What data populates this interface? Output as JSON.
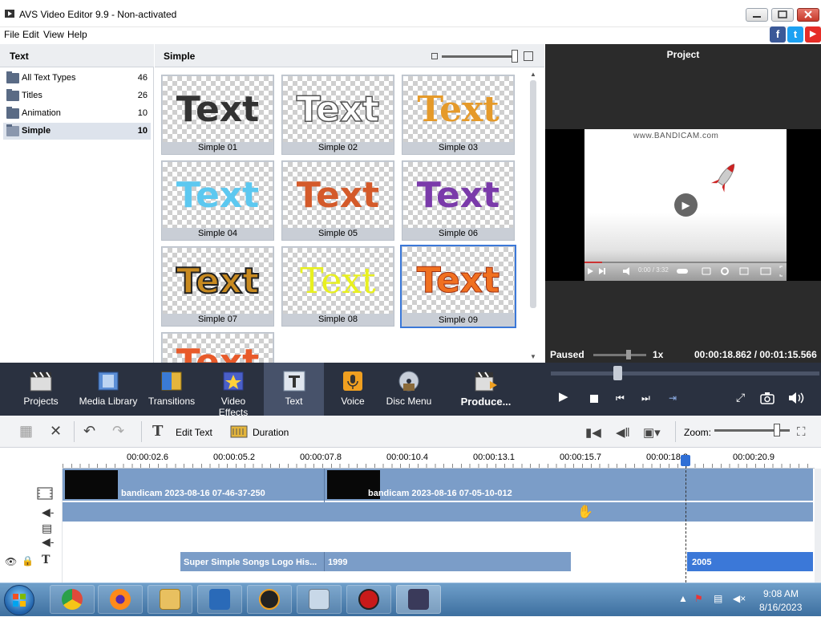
{
  "window": {
    "title": "AVS Video Editor 9.9 - Non-activated"
  },
  "menu": [
    "File",
    "Edit",
    "View",
    "Help"
  ],
  "social": [
    "f",
    "t",
    "▶"
  ],
  "left_panel": {
    "title": "Text",
    "categories": [
      {
        "label": "All Text Types",
        "count": "46"
      },
      {
        "label": "Titles",
        "count": "26"
      },
      {
        "label": "Animation",
        "count": "10"
      },
      {
        "label": "Simple",
        "count": "10"
      }
    ]
  },
  "gallery": {
    "title": "Simple",
    "preview_text": "Text",
    "tiles": [
      {
        "label": "Simple 01",
        "color": "#333333"
      },
      {
        "label": "Simple 02",
        "color": "#ffffff"
      },
      {
        "label": "Simple 03",
        "color": "#e59a2a"
      },
      {
        "label": "Simple 04",
        "color": "#5cc8f0"
      },
      {
        "label": "Simple 05",
        "color": "#d45a2a"
      },
      {
        "label": "Simple 06",
        "color": "#7a3aaa"
      },
      {
        "label": "Simple 07",
        "color": "#c88a20"
      },
      {
        "label": "Simple 08",
        "color": "#e8f020"
      },
      {
        "label": "Simple 09",
        "color": "#f07020"
      }
    ]
  },
  "project": {
    "title": "Project",
    "watermark": "www.BANDICAM.com",
    "video_time": "0:00 / 3:32",
    "status": "Paused",
    "speed": "1x",
    "time": "00:00:18.862 / 00:01:15.566"
  },
  "toolbar": {
    "items": [
      {
        "label": "Projects",
        "color": "#e9e9e9"
      },
      {
        "label": "Media Library",
        "color": "#5b8ed6"
      },
      {
        "label": "Transitions",
        "color": "#e4b53c"
      },
      {
        "label": "Video Effects",
        "color": "#6a7bd8"
      },
      {
        "label": "Text",
        "color": "#cfd6e2"
      },
      {
        "label": "Voice",
        "color": "#f0a020"
      },
      {
        "label": "Disc Menu",
        "color": "#9aa6b8"
      },
      {
        "label": "Produce...",
        "color": "#e8e8e8"
      }
    ]
  },
  "timeline_toolbar": {
    "edit_text": "Edit Text",
    "duration": "Duration",
    "zoom": "Zoom:"
  },
  "ruler": [
    "00:00:02.6",
    "00:00:05.2",
    "00:00:07.8",
    "00:00:10.4",
    "00:00:13.1",
    "00:00:15.7",
    "00:00:18.3",
    "00:00:20.9"
  ],
  "timeline": {
    "clips": [
      "bandicam 2023-08-16 07-46-37-250",
      "bandicam 2023-08-16 07-05-10-012"
    ],
    "text_clips": [
      "Super Simple Songs Logo His...",
      "1999",
      "2005"
    ]
  },
  "taskbar": {
    "time": "9:08 AM",
    "date": "8/16/2023",
    "apps": [
      {
        "name": "chrome",
        "color": "#e04a3a"
      },
      {
        "name": "firefox",
        "color": "#ff8a1a"
      },
      {
        "name": "explorer",
        "color": "#e8c060"
      },
      {
        "name": "avs",
        "color": "#2a6ab8"
      },
      {
        "name": "app-t",
        "color": "#222222"
      },
      {
        "name": "calculator",
        "color": "#c8d8e8"
      },
      {
        "name": "recorder",
        "color": "#c81a1a"
      },
      {
        "name": "video-editor",
        "color": "#3a3a5a"
      }
    ]
  },
  "colors": {
    "accent": "#3b78d8",
    "toolbar_bg": "#2a3140",
    "track": "#7b9dc8"
  }
}
